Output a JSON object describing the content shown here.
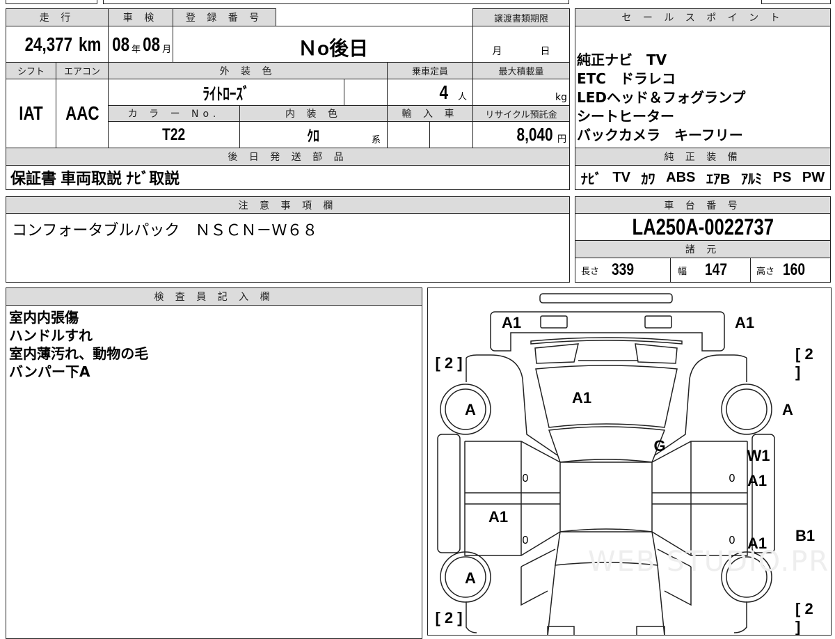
{
  "sheet": {
    "mileage_label": "走 行",
    "mileage_value": "24,377",
    "mileage_unit": "km",
    "inspection_label": "車 検",
    "inspection_year": "08",
    "year_unit": "年",
    "inspection_month": "08",
    "month_unit": "月",
    "registration_label": "登 録 番 号",
    "registration_value": "Ｎo後日",
    "transfer_deadline_label": "譲渡書類期限",
    "transfer_month_unit": "月",
    "transfer_day_unit": "日",
    "shift_label": "シフト",
    "shift_value": "IAT",
    "ac_label": "エアコン",
    "ac_value": "AAC",
    "exterior_color_label": "外 装 色",
    "exterior_color_value": "ﾗｲﾄﾛｰｽﾞ",
    "capacity_label": "乗車定員",
    "capacity_value": "4",
    "capacity_unit": "人",
    "max_load_label": "最大積載量",
    "max_load_unit": "kg",
    "color_no_label": "カ ラ ー No.",
    "color_no_value": "T22",
    "interior_color_label": "内 装 色",
    "interior_color_value": "ｸﾛ",
    "interior_suffix": "系",
    "import_label": "輸 入 車",
    "recycle_label": "リサイクル預託金",
    "recycle_value": "8,040",
    "recycle_unit": "円",
    "later_parts_label": "後 日 発 送 部 品",
    "later_parts_value": "保証書 車両取説 ﾅﾋﾞ取説"
  },
  "sales_points": {
    "label": "セ ー ル ス ポ イ ン ト",
    "lines": [
      "純正ナビ　TV",
      "ETC　ドラレコ",
      "LEDヘッド＆フォグランプ",
      "シートヒーター",
      "バックカメラ　キーフリー"
    ]
  },
  "equipment": {
    "label": "純 正 装 備",
    "items": [
      "ﾅﾋﾞ",
      "TV",
      "ｶﾜ",
      "ABS",
      "ｴｱB",
      "ｱﾙﾐ",
      "PS",
      "PW"
    ]
  },
  "notes": {
    "label": "注 意 事 項 欄",
    "value": "コンフォータブルパック　ＮＳＣＮ－Ｗ６８"
  },
  "chassis": {
    "label": "車 台 番 号",
    "value": "LA250A-0022737",
    "specs_label": "諸 元",
    "length_label": "長さ",
    "length_value": "339",
    "width_label": "幅",
    "width_value": "147",
    "height_label": "高さ",
    "height_value": "160"
  },
  "inspector": {
    "label": "検 査 員 記 入 欄",
    "lines": [
      "室内内張傷",
      "ハンドルすれ",
      "室内薄汚れ、動物の毛",
      "バンパー下A"
    ]
  },
  "diagram": {
    "marks": {
      "rear_left": "A1",
      "rear_right": "A1",
      "tire_rl": "[ 2 ]",
      "tire_rr": "[ 2 ]",
      "tire_fl": "[ 2 ]",
      "tire_fr": "[ 2 ]",
      "rear_glass": "A1",
      "wheel_rl": "A",
      "wheel_rr": "A",
      "wheel_fl": "A",
      "roof_rear": "G",
      "rear_door_right": "W1",
      "rear_door_right_2": "A1",
      "front_door_left": "A1",
      "front_door_right": "A1",
      "rocker_right": "B1",
      "zero": "0"
    },
    "watermark": "WEB STUDIO.PRO"
  }
}
